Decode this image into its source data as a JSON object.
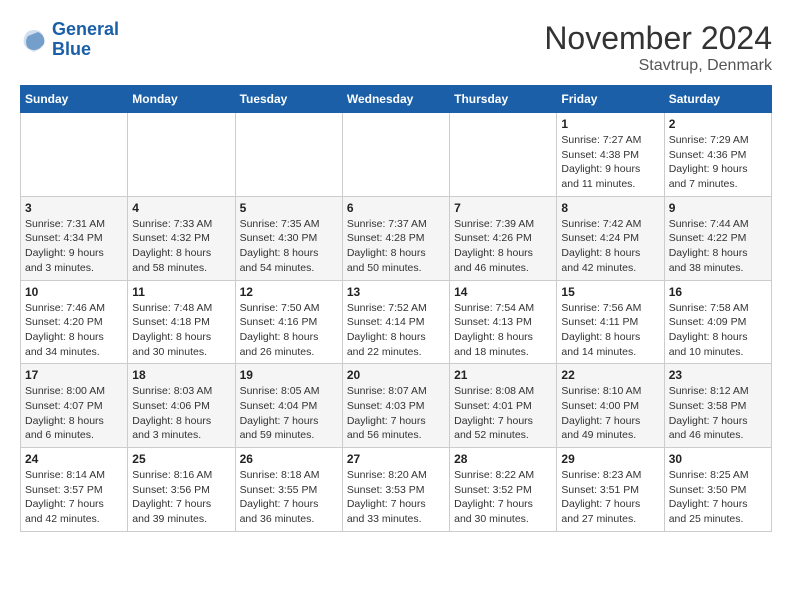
{
  "header": {
    "logo": {
      "line1": "General",
      "line2": "Blue"
    },
    "title": "November 2024",
    "subtitle": "Stavtrup, Denmark"
  },
  "days_of_week": [
    "Sunday",
    "Monday",
    "Tuesday",
    "Wednesday",
    "Thursday",
    "Friday",
    "Saturday"
  ],
  "weeks": [
    [
      {
        "day": "",
        "info": ""
      },
      {
        "day": "",
        "info": ""
      },
      {
        "day": "",
        "info": ""
      },
      {
        "day": "",
        "info": ""
      },
      {
        "day": "",
        "info": ""
      },
      {
        "day": "1",
        "info": "Sunrise: 7:27 AM\nSunset: 4:38 PM\nDaylight: 9 hours and 11 minutes."
      },
      {
        "day": "2",
        "info": "Sunrise: 7:29 AM\nSunset: 4:36 PM\nDaylight: 9 hours and 7 minutes."
      }
    ],
    [
      {
        "day": "3",
        "info": "Sunrise: 7:31 AM\nSunset: 4:34 PM\nDaylight: 9 hours and 3 minutes."
      },
      {
        "day": "4",
        "info": "Sunrise: 7:33 AM\nSunset: 4:32 PM\nDaylight: 8 hours and 58 minutes."
      },
      {
        "day": "5",
        "info": "Sunrise: 7:35 AM\nSunset: 4:30 PM\nDaylight: 8 hours and 54 minutes."
      },
      {
        "day": "6",
        "info": "Sunrise: 7:37 AM\nSunset: 4:28 PM\nDaylight: 8 hours and 50 minutes."
      },
      {
        "day": "7",
        "info": "Sunrise: 7:39 AM\nSunset: 4:26 PM\nDaylight: 8 hours and 46 minutes."
      },
      {
        "day": "8",
        "info": "Sunrise: 7:42 AM\nSunset: 4:24 PM\nDaylight: 8 hours and 42 minutes."
      },
      {
        "day": "9",
        "info": "Sunrise: 7:44 AM\nSunset: 4:22 PM\nDaylight: 8 hours and 38 minutes."
      }
    ],
    [
      {
        "day": "10",
        "info": "Sunrise: 7:46 AM\nSunset: 4:20 PM\nDaylight: 8 hours and 34 minutes."
      },
      {
        "day": "11",
        "info": "Sunrise: 7:48 AM\nSunset: 4:18 PM\nDaylight: 8 hours and 30 minutes."
      },
      {
        "day": "12",
        "info": "Sunrise: 7:50 AM\nSunset: 4:16 PM\nDaylight: 8 hours and 26 minutes."
      },
      {
        "day": "13",
        "info": "Sunrise: 7:52 AM\nSunset: 4:14 PM\nDaylight: 8 hours and 22 minutes."
      },
      {
        "day": "14",
        "info": "Sunrise: 7:54 AM\nSunset: 4:13 PM\nDaylight: 8 hours and 18 minutes."
      },
      {
        "day": "15",
        "info": "Sunrise: 7:56 AM\nSunset: 4:11 PM\nDaylight: 8 hours and 14 minutes."
      },
      {
        "day": "16",
        "info": "Sunrise: 7:58 AM\nSunset: 4:09 PM\nDaylight: 8 hours and 10 minutes."
      }
    ],
    [
      {
        "day": "17",
        "info": "Sunrise: 8:00 AM\nSunset: 4:07 PM\nDaylight: 8 hours and 6 minutes."
      },
      {
        "day": "18",
        "info": "Sunrise: 8:03 AM\nSunset: 4:06 PM\nDaylight: 8 hours and 3 minutes."
      },
      {
        "day": "19",
        "info": "Sunrise: 8:05 AM\nSunset: 4:04 PM\nDaylight: 7 hours and 59 minutes."
      },
      {
        "day": "20",
        "info": "Sunrise: 8:07 AM\nSunset: 4:03 PM\nDaylight: 7 hours and 56 minutes."
      },
      {
        "day": "21",
        "info": "Sunrise: 8:08 AM\nSunset: 4:01 PM\nDaylight: 7 hours and 52 minutes."
      },
      {
        "day": "22",
        "info": "Sunrise: 8:10 AM\nSunset: 4:00 PM\nDaylight: 7 hours and 49 minutes."
      },
      {
        "day": "23",
        "info": "Sunrise: 8:12 AM\nSunset: 3:58 PM\nDaylight: 7 hours and 46 minutes."
      }
    ],
    [
      {
        "day": "24",
        "info": "Sunrise: 8:14 AM\nSunset: 3:57 PM\nDaylight: 7 hours and 42 minutes."
      },
      {
        "day": "25",
        "info": "Sunrise: 8:16 AM\nSunset: 3:56 PM\nDaylight: 7 hours and 39 minutes."
      },
      {
        "day": "26",
        "info": "Sunrise: 8:18 AM\nSunset: 3:55 PM\nDaylight: 7 hours and 36 minutes."
      },
      {
        "day": "27",
        "info": "Sunrise: 8:20 AM\nSunset: 3:53 PM\nDaylight: 7 hours and 33 minutes."
      },
      {
        "day": "28",
        "info": "Sunrise: 8:22 AM\nSunset: 3:52 PM\nDaylight: 7 hours and 30 minutes."
      },
      {
        "day": "29",
        "info": "Sunrise: 8:23 AM\nSunset: 3:51 PM\nDaylight: 7 hours and 27 minutes."
      },
      {
        "day": "30",
        "info": "Sunrise: 8:25 AM\nSunset: 3:50 PM\nDaylight: 7 hours and 25 minutes."
      }
    ]
  ]
}
